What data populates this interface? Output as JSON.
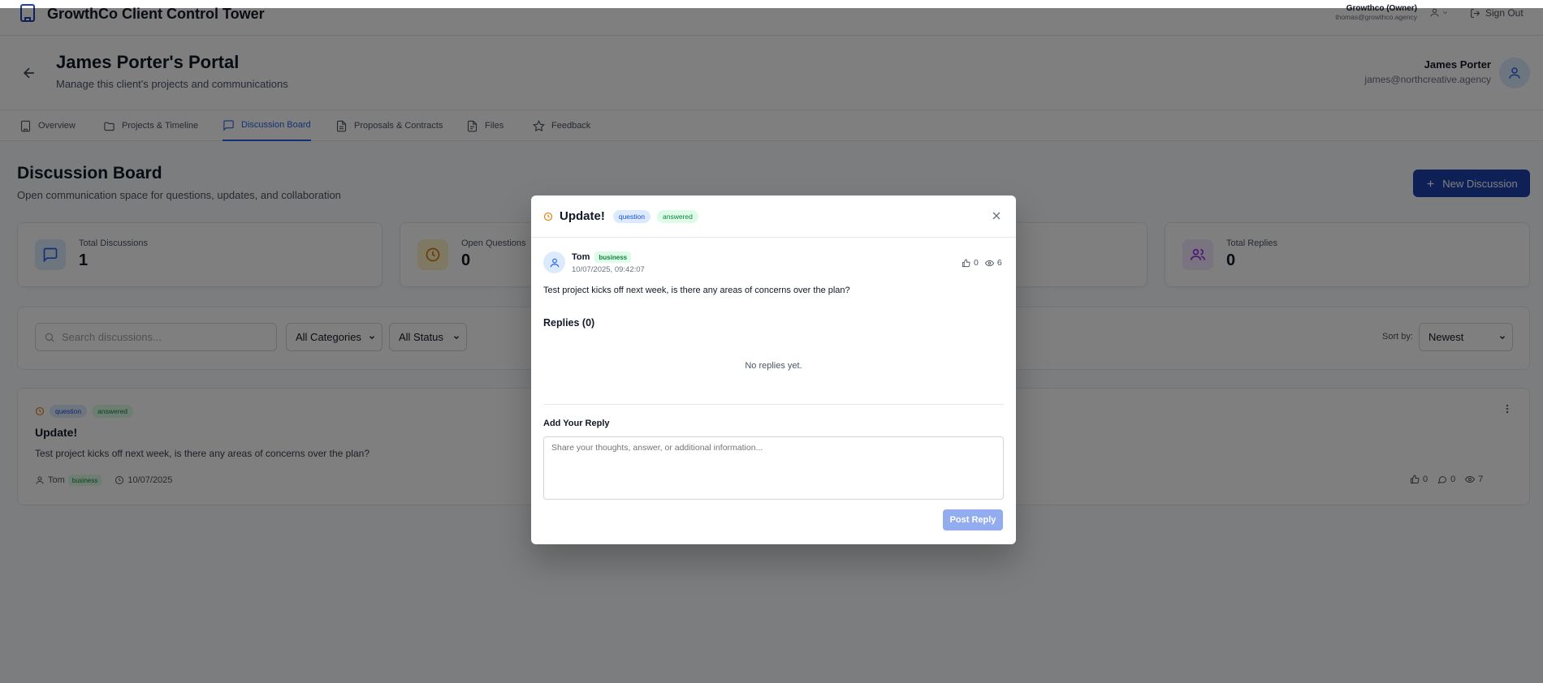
{
  "header": {
    "app_title": "GrowthCo Client Control Tower",
    "account_name": "Growthco (Owner)",
    "account_email": "thomas@growthco.agency",
    "sign_out": "Sign Out"
  },
  "portal": {
    "title": "James Porter's Portal",
    "subtitle": "Manage this client's projects and communications",
    "client_name": "James Porter",
    "client_email": "james@northcreative.agency"
  },
  "tabs": [
    {
      "label": "Overview",
      "icon": "building-icon"
    },
    {
      "label": "Projects & Timeline",
      "icon": "folder-icon"
    },
    {
      "label": "Discussion Board",
      "icon": "message-icon",
      "active": true
    },
    {
      "label": "Proposals & Contracts",
      "icon": "document-icon"
    },
    {
      "label": "Files",
      "icon": "file-icon"
    },
    {
      "label": "Feedback",
      "icon": "star-icon"
    }
  ],
  "board": {
    "title": "Discussion Board",
    "subtitle": "Open communication space for questions, updates, and collaboration",
    "new_button": "New Discussion"
  },
  "stats": [
    {
      "label": "Total Discussions",
      "value": "1",
      "color": "#dbeafe"
    },
    {
      "label": "Open Questions",
      "value": "0",
      "color": "#fef3c7"
    },
    {
      "label": "Total Replies",
      "value": "0",
      "color": "#f3e8ff"
    }
  ],
  "filters": {
    "search_placeholder": "Search discussions...",
    "category": "All Categories",
    "status": "All Status",
    "sort_label": "Sort by:",
    "sort_value": "Newest"
  },
  "post": {
    "category": "question",
    "status": "answered",
    "title": "Update!",
    "body": "Test project kicks off next week, is there any areas of concerns over the plan?",
    "author": "Tom",
    "author_role": "business",
    "date": "10/07/2025",
    "likes": "0",
    "comments": "0",
    "views": "7"
  },
  "modal": {
    "title": "Update!",
    "category": "question",
    "status": "answered",
    "author": "Tom",
    "author_role": "business",
    "timestamp": "10/07/2025, 09:42:07",
    "likes": "0",
    "views": "6",
    "body": "Test project kicks off next week, is there any areas of concerns over the plan?",
    "replies_title": "Replies (0)",
    "no_replies": "No replies yet.",
    "reply_label": "Add Your Reply",
    "reply_placeholder": "Share your thoughts, answer, or additional information...",
    "post_button": "Post Reply"
  }
}
